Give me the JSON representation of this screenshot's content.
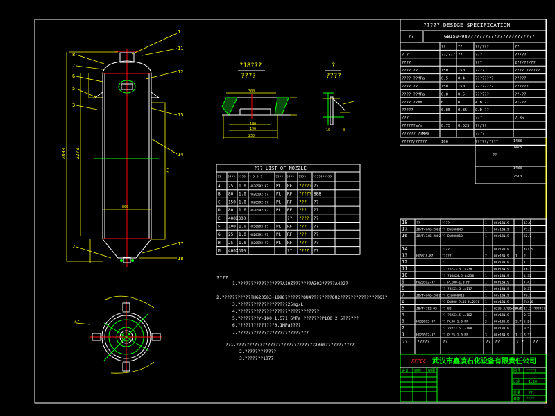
{
  "colors": {
    "background": "#000000",
    "frame": "#ffffff",
    "dimension": "#ffff00",
    "centerline": "#ff0000",
    "title_block": "#00ff00"
  },
  "spec": {
    "title": "?????   DESIGE  SPECIFICATION",
    "code_label": "??",
    "code_value": "GB150-98???????????????????????",
    "header": [
      "",
      "??",
      "??",
      "??/???",
      "??"
    ],
    "rows": [
      [
        "?  ?",
        "??/???",
        "??",
        "???",
        "??/??"
      ],
      [
        "????",
        "",
        "",
        "???",
        "2??/??/??"
      ],
      [
        "????  ??",
        "150",
        "150",
        "????",
        "???? ??????"
      ],
      [
        "????  ??MPa",
        "0.5",
        "0.4",
        "????????",
        "?????"
      ],
      [
        "????  ??",
        "150",
        "150",
        "????????",
        "??????"
      ],
      [
        "????  ??MPa",
        "0.8",
        "0.5",
        "??????",
        "??-??"
      ],
      [
        "????  ??mm",
        "0",
        "0",
        "A.B  ??",
        "RT-??"
      ],
      [
        "?????",
        "0.85",
        "0.85",
        "C.D  ??",
        ""
      ],
      [
        "???",
        "",
        "",
        "???",
        "2.35"
      ],
      [
        "??????m/m",
        "0.75",
        "0.625",
        "??/??",
        ""
      ],
      [
        "??????  ??MPa",
        "",
        "",
        "????",
        ""
      ],
      [
        "?????/?????",
        "100",
        "",
        "?????/????",
        ""
      ]
    ],
    "extra": [
      "1488",
      "1478",
      "??",
      "1488",
      "2510"
    ]
  },
  "sections": [
    {
      "title": "?18???",
      "subtitle": "????",
      "dims": [
        "300",
        "80",
        "180",
        "190",
        "230",
        "70",
        "8"
      ]
    },
    {
      "title": "?",
      "subtitle": "????",
      "dims": [
        "10",
        "8"
      ]
    }
  ],
  "nozzle": {
    "title": "???   LIST   OF   NOZZLE",
    "header": [
      "??",
      "????",
      "????",
      "? ? ? ?",
      "????",
      "????",
      "????",
      "??????????"
    ],
    "rows": [
      [
        "A",
        "25",
        "1.0",
        "HG20592-97",
        "PL",
        "RF",
        "?????",
        "??"
      ],
      [
        "B",
        "80",
        "1.0",
        "HG20592-97",
        "PL",
        "RF",
        "?????",
        "888"
      ],
      [
        "C",
        "150",
        "1.0",
        "HG20592-97",
        "PL",
        "RF",
        "???",
        "??"
      ],
      [
        "D",
        "80",
        "1.0",
        "HG20592-97",
        "PL",
        "RF",
        "???",
        "??"
      ],
      [
        "E",
        "400X300",
        "",
        "",
        "",
        "??",
        "????",
        "??"
      ],
      [
        "F",
        "100",
        "1.0",
        "HG20592-97",
        "PL",
        "RF",
        "???",
        "??"
      ],
      [
        "G",
        "25",
        "1.0",
        "HG20592-97",
        "PL",
        "RF",
        "???",
        "??"
      ],
      [
        "H",
        "25",
        "1.0",
        "HG20592-97",
        "PL",
        "RF",
        "???",
        "??"
      ],
      [
        "M",
        "400X300",
        "",
        "",
        "",
        "??",
        "????",
        "??"
      ]
    ]
  },
  "notes": {
    "heading": "????",
    "lines": [
      "1.?????????????????A10Z???????A302?????A422?",
      "2.????????????HG20583-1998???????OU4????????OU2???????????????G1?",
      "3.???????????????????25mg/L",
      "4.???????????????????????????????",
      "5.????????Y-100   1.571.6MPa,???????P100   2.5??????",
      "6.??????????????0.1MPa????",
      "7.???????????????????????????",
      "??1.??????????????????????????????20mm???????????",
      "2.????????????",
      "3.???????1077"
    ]
  },
  "parts": {
    "rows": [
      [
        "18",
        "??",
        "????",
        "1",
        "0Cr18Ni9",
        "",
        "13.0",
        ""
      ],
      [
        "17",
        "JB/T4746-2002",
        "?? DN1000X8",
        "1",
        "0Cr18Ni9",
        "",
        "71.1",
        ""
      ],
      [
        "16",
        "JB/T4746-2002",
        "?? DN800X10",
        "1",
        "0Cr18Ni9",
        "",
        "62.7",
        ""
      ],
      [
        "",
        "",
        "",
        "",
        "",
        "",
        "",
        ""
      ],
      [
        "14",
        "",
        "????",
        "1",
        "0Cr18Ni9",
        "",
        "441.5",
        ""
      ],
      [
        "13",
        "HG5818-87",
        "?????",
        "2",
        "0Cr18Ni9",
        "1",
        "2",
        ""
      ],
      [
        "12",
        "",
        "??",
        "1",
        "0Cr18Ni9",
        "",
        "1",
        ""
      ],
      [
        "11",
        "",
        "?? ?57X3.5 L=230",
        "1",
        "0Cr18Ni9",
        "",
        "16.3",
        ""
      ],
      [
        "10",
        "",
        "?? ?108X4.5 L=258",
        "1",
        "0Cr18Ni9",
        "",
        "4.32",
        ""
      ],
      [
        "9",
        "HG20592-97",
        "?? PL100-1.0 RF",
        "1",
        "0Cr18Ni9",
        "",
        "7.41",
        ""
      ],
      [
        "8",
        "",
        "?? ?32X3.5 L=117",
        "1",
        "0Cr18Ni9",
        "",
        "0.31",
        ""
      ],
      [
        "7",
        "JB/T4746-2002",
        "?? EHA800X10",
        "1",
        "0Cr18Ni9",
        "",
        "76.1",
        ""
      ],
      [
        "6",
        "",
        "?? DN800 ?=10 H=2270",
        "1",
        "0Cr18Ni9",
        "",
        "744.8",
        ""
      ],
      [
        "5",
        "JB/T4712-92",
        "?? B2",
        "4",
        "Q235-A/0Cr18Ni9",
        "4.31",
        "17.2",
        "???????"
      ],
      [
        "4",
        "",
        "?? ?32X3.5 L=182",
        "1",
        "0Cr18Ni9",
        "",
        "0.73",
        ""
      ],
      [
        "3",
        "HG20592-97",
        "?? PL80-1.0 RF",
        "2",
        "0Cr18Ni9",
        "2.77",
        "5.54",
        ""
      ],
      [
        "2",
        "",
        "?? ?32X3.5 L=180",
        "1",
        "0Cr18Ni9",
        "",
        "0.57",
        ""
      ],
      [
        "1",
        "HG20592-97",
        "?? PL25-1.0 RF",
        "3",
        "0Cr18Ni9",
        "1.12",
        "3.31",
        ""
      ]
    ],
    "header": [
      "??",
      "?????",
      "??",
      "??",
      "??",
      "?  ?",
      "??"
    ]
  },
  "title_block": {
    "logo": "XFPEC",
    "company": "武汉市鑫凌石化设备有限责任公司",
    "left_labels": [
      "设计",
      "审核",
      "制图"
    ],
    "right_labels": [
      "图号",
      "比例",
      "重量",
      "日期"
    ],
    "right_values": [
      "?????",
      "1:20",
      "??",
      "????"
    ]
  },
  "vessel": {
    "callouts": [
      "1",
      "2",
      "3",
      "4",
      "5",
      "6",
      "7",
      "8",
      "9",
      "10",
      "11",
      "12",
      "13",
      "14",
      "15",
      "16",
      "17",
      "18"
    ],
    "dims": [
      "2800",
      "2270",
      "800",
      "300",
      "??"
    ]
  }
}
